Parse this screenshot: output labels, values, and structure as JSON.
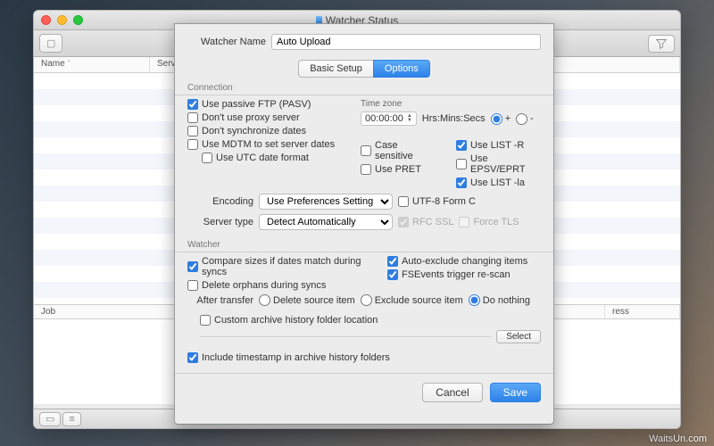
{
  "desktop": {
    "watermark": "WaitsUn.com"
  },
  "window": {
    "title": "Watcher Status"
  },
  "list": {
    "col_name": "Name",
    "col_server": "Server"
  },
  "jobs": {
    "col_job": "Job",
    "col_progress": "ress"
  },
  "sheet": {
    "watcher_name_label": "Watcher Name",
    "watcher_name_value": "Auto Upload",
    "tabs": [
      "Basic Setup",
      "Options"
    ],
    "connection": {
      "group": "Connection",
      "pasv": "Use passive FTP (PASV)",
      "noproxy": "Don't use proxy server",
      "nosyncdates": "Don't synchronize dates",
      "mdtm": "Use MDTM to set server dates",
      "utc": "Use UTC date format",
      "timezone_label": "Time zone",
      "timezone_value": "00:00:00",
      "timezone_units": "Hrs:Mins:Secs",
      "tz_plus": "+",
      "tz_minus": "-",
      "case": "Case sensitive",
      "pret": "Use PRET",
      "listr": "Use LIST -R",
      "epsv": "Use EPSV/EPRT",
      "listla": "Use LIST -la",
      "encoding_label": "Encoding",
      "encoding_value": "Use Preferences Setting",
      "utf8formc": "UTF-8 Form C",
      "servertype_label": "Server type",
      "servertype_value": "Detect Automatically",
      "rfcssl": "RFC SSL",
      "forcetls": "Force TLS"
    },
    "watcher": {
      "group": "Watcher",
      "compare_sizes": "Compare sizes if dates match during syncs",
      "delete_orphans": "Delete orphans during syncs",
      "auto_exclude": "Auto-exclude changing items",
      "fsevents": "FSEvents trigger re-scan",
      "after_transfer_label": "After transfer",
      "after_delete": "Delete source item",
      "after_exclude": "Exclude source item",
      "after_nothing": "Do nothing",
      "custom_archive": "Custom archive history folder location",
      "select_btn": "Select",
      "include_timestamp": "Include timestamp in archive history folders"
    },
    "buttons": {
      "cancel": "Cancel",
      "save": "Save"
    }
  }
}
